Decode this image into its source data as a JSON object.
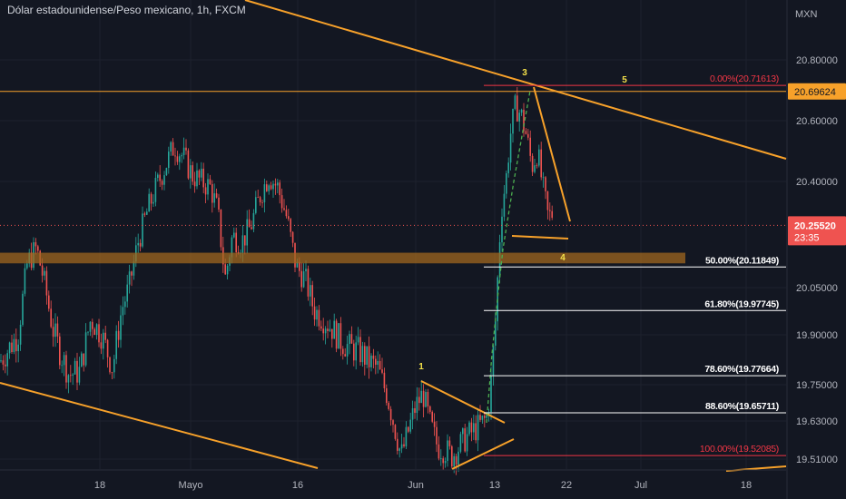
{
  "header": {
    "title": "Dólar estadounidense/Peso mexicano, 1h, FXCM"
  },
  "axis": {
    "currency": "MXN"
  },
  "colors": {
    "background": "#131722",
    "grid": "#1e222d",
    "up": "#26a69a",
    "down": "#ef5350",
    "trendline": "#f7a12a",
    "zone": "#a0671f",
    "fib_red": "#f23645",
    "fib_white": "#ffffff",
    "label_yellow": "#f5e24a",
    "green_path": "#4caf50"
  },
  "chart_data": {
    "type": "candlestick",
    "title": "Dólar estadounidense/Peso mexicano, 1h, FXCM",
    "ylim": [
      19.48,
      20.95
    ],
    "x_tick_labels": [
      "18",
      "Mayo",
      "16",
      "Jun",
      "13",
      "22",
      "Jul",
      "18"
    ],
    "y_tick_labels": [
      "20.80000",
      "20.60000",
      "20.40000",
      "20.05000",
      "19.90000",
      "19.75000",
      "19.63000",
      "19.51000"
    ],
    "y_tick_values": [
      20.8,
      20.6,
      20.4,
      20.05,
      19.9,
      19.75,
      19.63,
      19.51
    ],
    "price_path": [
      [
        0,
        19.82
      ],
      [
        20,
        19.9
      ],
      [
        30,
        20.13
      ],
      [
        40,
        20.18
      ],
      [
        48,
        20.08
      ],
      [
        58,
        19.92
      ],
      [
        66,
        19.85
      ],
      [
        76,
        19.78
      ],
      [
        88,
        19.79
      ],
      [
        100,
        19.95
      ],
      [
        112,
        19.9
      ],
      [
        124,
        19.8
      ],
      [
        134,
        19.98
      ],
      [
        142,
        20.05
      ],
      [
        152,
        20.2
      ],
      [
        162,
        20.3
      ],
      [
        172,
        20.38
      ],
      [
        182,
        20.45
      ],
      [
        192,
        20.52
      ],
      [
        202,
        20.48
      ],
      [
        212,
        20.42
      ],
      [
        222,
        20.4
      ],
      [
        232,
        20.38
      ],
      [
        240,
        20.3
      ],
      [
        248,
        20.08
      ],
      [
        256,
        20.22
      ],
      [
        266,
        20.2
      ],
      [
        276,
        20.25
      ],
      [
        286,
        20.35
      ],
      [
        296,
        20.42
      ],
      [
        306,
        20.38
      ],
      [
        316,
        20.28
      ],
      [
        326,
        20.12
      ],
      [
        336,
        20.08
      ],
      [
        346,
        19.98
      ],
      [
        356,
        19.95
      ],
      [
        366,
        19.92
      ],
      [
        376,
        19.88
      ],
      [
        386,
        19.86
      ],
      [
        396,
        19.85
      ],
      [
        406,
        19.82
      ],
      [
        416,
        19.8
      ],
      [
        426,
        19.72
      ],
      [
        434,
        19.62
      ],
      [
        442,
        19.52
      ],
      [
        450,
        19.6
      ],
      [
        458,
        19.68
      ],
      [
        466,
        19.72
      ],
      [
        474,
        19.62
      ],
      [
        482,
        19.55
      ],
      [
        490,
        19.54
      ],
      [
        498,
        19.52
      ],
      [
        506,
        19.55
      ],
      [
        514,
        19.58
      ],
      [
        522,
        19.6
      ],
      [
        530,
        19.62
      ],
      [
        536,
        19.64
      ],
      [
        540,
        19.72
      ],
      [
        546,
        19.95
      ],
      [
        552,
        20.3
      ],
      [
        558,
        20.42
      ],
      [
        562,
        20.55
      ],
      [
        568,
        20.65
      ],
      [
        574,
        20.62
      ],
      [
        580,
        20.55
      ],
      [
        586,
        20.45
      ],
      [
        592,
        20.5
      ],
      [
        598,
        20.38
      ],
      [
        604,
        20.28
      ],
      [
        610,
        20.3
      ]
    ],
    "horizontal_level": {
      "value": 20.69624,
      "label": "20.69624"
    },
    "current_price": {
      "value": 20.2552,
      "label": "20.25520",
      "countdown": "23:35"
    },
    "support_zone": {
      "from": 20.13,
      "to": 20.165
    },
    "fibonacci": [
      {
        "ratio": "0.00%",
        "price": "20.71613",
        "value": 20.716,
        "color": "red"
      },
      {
        "ratio": "50.00%",
        "price": "20.11849",
        "value": 20.118,
        "color": "white"
      },
      {
        "ratio": "61.80%",
        "price": "19.97745",
        "value": 19.977,
        "color": "white"
      },
      {
        "ratio": "78.60%",
        "price": "19.77664",
        "value": 19.777,
        "color": "white"
      },
      {
        "ratio": "88.60%",
        "price": "19.65711",
        "value": 19.657,
        "color": "white"
      },
      {
        "ratio": "100.00%",
        "price": "19.52085",
        "value": 19.521,
        "color": "red"
      }
    ],
    "wave_labels": [
      "1",
      "3",
      "4",
      "5"
    ]
  }
}
